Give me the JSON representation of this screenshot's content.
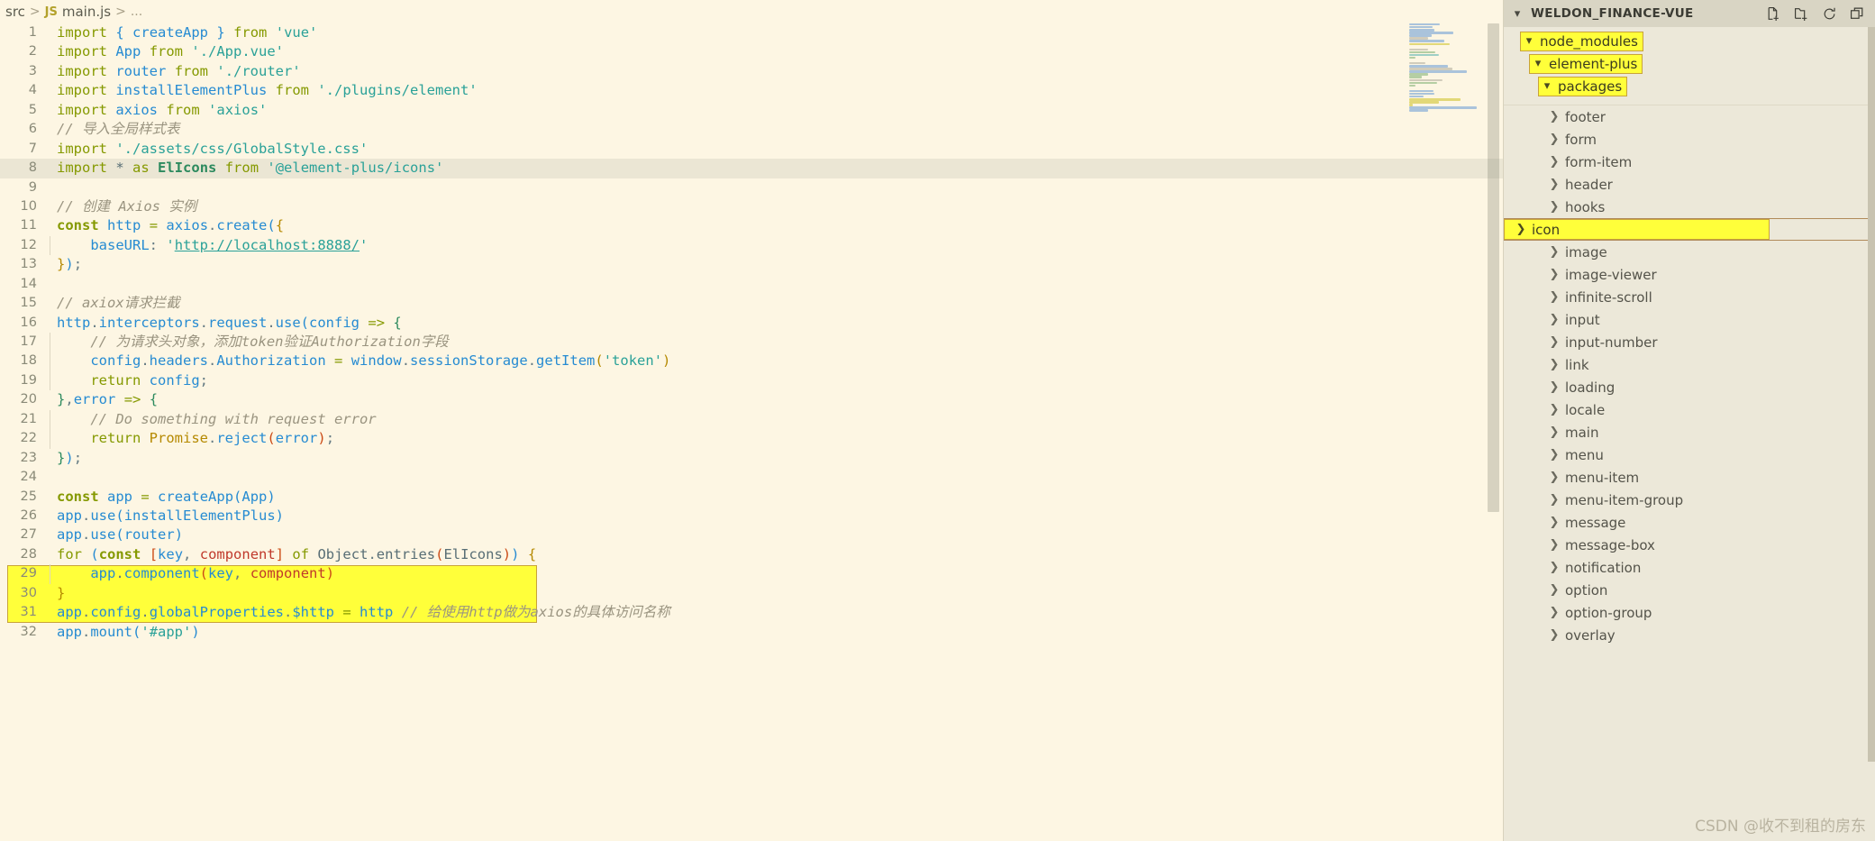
{
  "editor": {
    "breadcrumb": {
      "root": "src",
      "separator": ">",
      "file_badge": "JS",
      "file": "main.js",
      "ellipsis": "..."
    },
    "lines": [
      {
        "n": "1",
        "text": "import { createApp } from 'vue'"
      },
      {
        "n": "2",
        "text": "import App from './App.vue'"
      },
      {
        "n": "3",
        "text": "import router from './router'"
      },
      {
        "n": "4",
        "text": "import installElementPlus from './plugins/element'"
      },
      {
        "n": "5",
        "text": "import axios from 'axios'"
      },
      {
        "n": "6",
        "text": "// 导入全局样式表"
      },
      {
        "n": "7",
        "text": "import './assets/css/GlobalStyle.css'"
      },
      {
        "n": "8",
        "text": "import * as ElIcons from '@element-plus/icons'"
      },
      {
        "n": "9",
        "text": ""
      },
      {
        "n": "10",
        "text": "// 创建 Axios 实例"
      },
      {
        "n": "11",
        "text": "const http = axios.create({"
      },
      {
        "n": "12",
        "text": "    baseURL: 'http://localhost:8888/'"
      },
      {
        "n": "13",
        "text": "});"
      },
      {
        "n": "14",
        "text": ""
      },
      {
        "n": "15",
        "text": "// axiox请求拦截"
      },
      {
        "n": "16",
        "text": "http.interceptors.request.use(config => {"
      },
      {
        "n": "17",
        "text": "    // 为请求头对象，添加token验证Authorization字段"
      },
      {
        "n": "18",
        "text": "    config.headers.Authorization = window.sessionStorage.getItem('token')"
      },
      {
        "n": "19",
        "text": "    return config;"
      },
      {
        "n": "20",
        "text": "},error => {"
      },
      {
        "n": "21",
        "text": "    // Do something with request error"
      },
      {
        "n": "22",
        "text": "    return Promise.reject(error);"
      },
      {
        "n": "23",
        "text": "});"
      },
      {
        "n": "24",
        "text": ""
      },
      {
        "n": "25",
        "text": "const app = createApp(App)"
      },
      {
        "n": "26",
        "text": "app.use(installElementPlus)"
      },
      {
        "n": "27",
        "text": "app.use(router)"
      },
      {
        "n": "28",
        "text": "for (const [key, component] of Object.entries(ElIcons)) {"
      },
      {
        "n": "29",
        "text": "    app.component(key, component)"
      },
      {
        "n": "30",
        "text": "}"
      },
      {
        "n": "31",
        "text": "app.config.globalProperties.$http = http // 给使用http做为axios的具体访问名称"
      },
      {
        "n": "32",
        "text": "app.mount('#app')"
      }
    ],
    "highlight_blocks": [
      {
        "name": "import-elicons-highlight",
        "lines": "8"
      },
      {
        "name": "for-loop-highlight",
        "lines": "28-30"
      }
    ],
    "colors": {
      "background": "#fdf6e3",
      "keyword": "#859900",
      "identifier": "#268bd2",
      "string": "#2aa198",
      "comment": "#9a9480",
      "highlight": "#ffff3a",
      "highlight_border": "#c8a33a"
    }
  },
  "sidebar": {
    "title": "WELDON_FINANCE-VUE",
    "header_chevron": "chevron-down",
    "actions": [
      {
        "name": "new-file-icon",
        "tooltip": "New File"
      },
      {
        "name": "new-folder-icon",
        "tooltip": "New Folder"
      },
      {
        "name": "refresh-icon",
        "tooltip": "Refresh Explorer"
      },
      {
        "name": "collapse-all-icon",
        "tooltip": "Collapse Folders in Explorer"
      }
    ],
    "tree": [
      {
        "label": "node_modules",
        "indent": 1,
        "chevron": "down",
        "state": "highlighted"
      },
      {
        "label": "element-plus",
        "indent": 2,
        "chevron": "down",
        "state": "highlighted"
      },
      {
        "label": "packages",
        "indent": 3,
        "chevron": "down",
        "state": "highlighted"
      },
      {
        "label": "footer",
        "indent": 4,
        "chevron": "right",
        "state": "normal"
      },
      {
        "label": "form",
        "indent": 4,
        "chevron": "right",
        "state": "normal"
      },
      {
        "label": "form-item",
        "indent": 4,
        "chevron": "right",
        "state": "normal"
      },
      {
        "label": "header",
        "indent": 4,
        "chevron": "right",
        "state": "normal"
      },
      {
        "label": "hooks",
        "indent": 4,
        "chevron": "right",
        "state": "normal"
      },
      {
        "label": "icon",
        "indent": 4,
        "chevron": "right",
        "state": "selected"
      },
      {
        "label": "image",
        "indent": 4,
        "chevron": "right",
        "state": "normal"
      },
      {
        "label": "image-viewer",
        "indent": 4,
        "chevron": "right",
        "state": "normal"
      },
      {
        "label": "infinite-scroll",
        "indent": 4,
        "chevron": "right",
        "state": "normal"
      },
      {
        "label": "input",
        "indent": 4,
        "chevron": "right",
        "state": "normal"
      },
      {
        "label": "input-number",
        "indent": 4,
        "chevron": "right",
        "state": "normal"
      },
      {
        "label": "link",
        "indent": 4,
        "chevron": "right",
        "state": "normal"
      },
      {
        "label": "loading",
        "indent": 4,
        "chevron": "right",
        "state": "normal"
      },
      {
        "label": "locale",
        "indent": 4,
        "chevron": "right",
        "state": "normal"
      },
      {
        "label": "main",
        "indent": 4,
        "chevron": "right",
        "state": "normal"
      },
      {
        "label": "menu",
        "indent": 4,
        "chevron": "right",
        "state": "normal"
      },
      {
        "label": "menu-item",
        "indent": 4,
        "chevron": "right",
        "state": "normal"
      },
      {
        "label": "menu-item-group",
        "indent": 4,
        "chevron": "right",
        "state": "normal"
      },
      {
        "label": "message",
        "indent": 4,
        "chevron": "right",
        "state": "normal"
      },
      {
        "label": "message-box",
        "indent": 4,
        "chevron": "right",
        "state": "normal"
      },
      {
        "label": "notification",
        "indent": 4,
        "chevron": "right",
        "state": "normal"
      },
      {
        "label": "option",
        "indent": 4,
        "chevron": "right",
        "state": "normal"
      },
      {
        "label": "option-group",
        "indent": 4,
        "chevron": "right",
        "state": "normal"
      },
      {
        "label": "overlay",
        "indent": 4,
        "chevron": "right",
        "state": "normal"
      }
    ]
  },
  "watermark": "CSDN @收不到租的房东"
}
